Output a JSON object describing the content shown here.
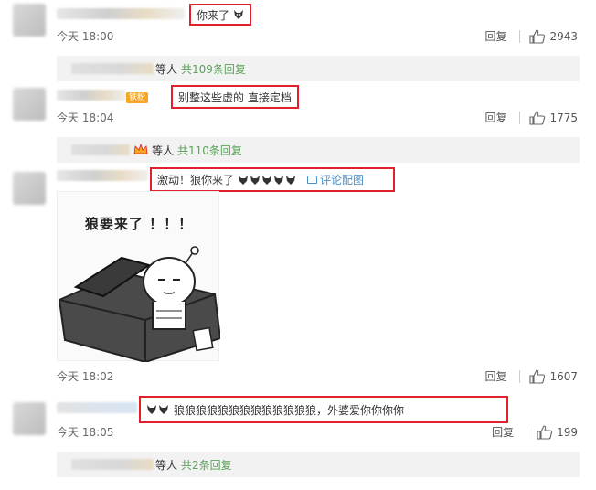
{
  "comments": [
    {
      "text": "你来了",
      "emoji": "wolf-emoji",
      "time": "今天 18:00",
      "reply": "回复",
      "likes": "2943",
      "sub_text": "等人",
      "sub_count": "共109条回复"
    },
    {
      "badge": "铁粉",
      "text": "别整这些虚的 直接定档",
      "time": "今天 18:04",
      "reply": "回复",
      "likes": "1775",
      "sub_text": "等人",
      "sub_count": "共110条回复"
    },
    {
      "text": "激动！狼你来了",
      "pic_link": "评论配图",
      "meme_caption": "狼要来了 ！！！",
      "time": "今天 18:02",
      "reply": "回复",
      "likes": "1607"
    },
    {
      "text": "狼狼狼狼狼狼狼狼狼狼狼狼狼，外婆爱你你你你",
      "time": "今天 18:05",
      "reply": "回复",
      "likes": "199",
      "sub_text": "等人",
      "sub_count": "共2条回复"
    }
  ],
  "colors": {
    "highlight": "#e0202a",
    "link": "#4a90c8",
    "reply_count": "#5aa35a",
    "badge": "#f5a623"
  }
}
